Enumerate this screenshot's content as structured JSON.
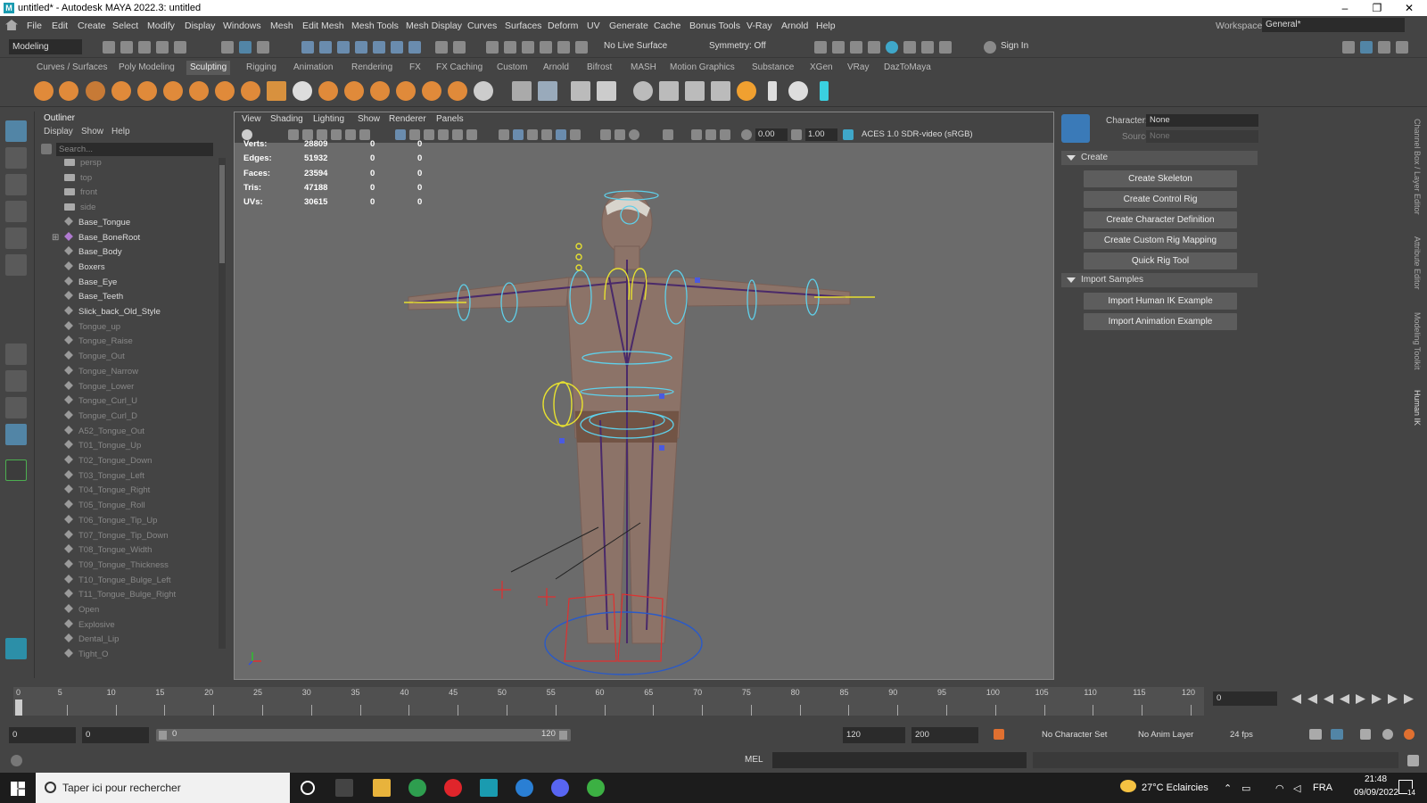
{
  "window": {
    "title": "untitled* - Autodesk MAYA 2022.3: untitled",
    "minimize": "–",
    "restore": "❐",
    "close": "✕"
  },
  "menubar": {
    "items": [
      "File",
      "Edit",
      "Create",
      "Select",
      "Modify",
      "Display",
      "Windows",
      "Mesh",
      "Edit Mesh",
      "Mesh Tools",
      "Mesh Display",
      "Curves",
      "Surfaces",
      "Deform",
      "UV",
      "Generate",
      "Cache",
      "Bonus Tools",
      "V-Ray",
      "Arnold",
      "Help"
    ],
    "workspace_label": "Workspace:",
    "workspace_value": "General*"
  },
  "toolbar": {
    "mode": "Modeling",
    "live_surface": "No Live Surface",
    "symmetry": "Symmetry: Off",
    "sign_in": "Sign In"
  },
  "shelf": {
    "tabs": [
      "Curves / Surfaces",
      "Poly Modeling",
      "Sculpting",
      "Rigging",
      "Animation",
      "Rendering",
      "FX",
      "FX Caching",
      "Custom",
      "Arnold",
      "Bifrost",
      "MASH",
      "Motion Graphics",
      "Substance",
      "XGen",
      "VRay",
      "DazToMaya"
    ],
    "active_tab": "Sculpting"
  },
  "outliner": {
    "title": "Outliner",
    "menus": [
      "Display",
      "Show",
      "Help"
    ],
    "search_placeholder": "Search...",
    "items": [
      {
        "label": "persp",
        "type": "camera"
      },
      {
        "label": "top",
        "type": "camera"
      },
      {
        "label": "front",
        "type": "camera"
      },
      {
        "label": "side",
        "type": "camera"
      },
      {
        "label": "Base_Tongue",
        "type": "mesh"
      },
      {
        "label": "Base_BoneRoot",
        "type": "joint"
      },
      {
        "label": "Base_Body",
        "type": "mesh"
      },
      {
        "label": "Boxers",
        "type": "mesh"
      },
      {
        "label": "Base_Eye",
        "type": "mesh"
      },
      {
        "label": "Base_Teeth",
        "type": "mesh"
      },
      {
        "label": "Slick_back_Old_Style",
        "type": "mesh"
      },
      {
        "label": "Tongue_up",
        "type": "blend"
      },
      {
        "label": "Tongue_Raise",
        "type": "blend"
      },
      {
        "label": "Tongue_Out",
        "type": "blend"
      },
      {
        "label": "Tongue_Narrow",
        "type": "blend"
      },
      {
        "label": "Tongue_Lower",
        "type": "blend"
      },
      {
        "label": "Tongue_Curl_U",
        "type": "blend"
      },
      {
        "label": "Tongue_Curl_D",
        "type": "blend"
      },
      {
        "label": "A52_Tongue_Out",
        "type": "blend"
      },
      {
        "label": "T01_Tongue_Up",
        "type": "blend"
      },
      {
        "label": "T02_Tongue_Down",
        "type": "blend"
      },
      {
        "label": "T03_Tongue_Left",
        "type": "blend"
      },
      {
        "label": "T04_Tongue_Right",
        "type": "blend"
      },
      {
        "label": "T05_Tongue_Roll",
        "type": "blend"
      },
      {
        "label": "T06_Tongue_Tip_Up",
        "type": "blend"
      },
      {
        "label": "T07_Tongue_Tip_Down",
        "type": "blend"
      },
      {
        "label": "T08_Tongue_Width",
        "type": "blend"
      },
      {
        "label": "T09_Tongue_Thickness",
        "type": "blend"
      },
      {
        "label": "T10_Tongue_Bulge_Left",
        "type": "blend"
      },
      {
        "label": "T11_Tongue_Bulge_Right",
        "type": "blend"
      },
      {
        "label": "Open",
        "type": "blend"
      },
      {
        "label": "Explosive",
        "type": "blend"
      },
      {
        "label": "Dental_Lip",
        "type": "blend"
      },
      {
        "label": "Tight_O",
        "type": "blend"
      }
    ]
  },
  "viewport": {
    "menus": [
      "View",
      "Shading",
      "Lighting",
      "Show",
      "Renderer",
      "Panels"
    ],
    "exposure": "0.00",
    "gamma": "1.00",
    "color_space": "ACES 1.0 SDR-video (sRGB)",
    "hud": [
      {
        "label": "Verts:",
        "value": "28809",
        "sel": "0",
        "comp": "0"
      },
      {
        "label": "Edges:",
        "value": "51932",
        "sel": "0",
        "comp": "0"
      },
      {
        "label": "Faces:",
        "value": "23594",
        "sel": "0",
        "comp": "0"
      },
      {
        "label": "Tris:",
        "value": "47188",
        "sel": "0",
        "comp": "0"
      },
      {
        "label": "UVs:",
        "value": "30615",
        "sel": "0",
        "comp": "0"
      }
    ]
  },
  "humanik": {
    "character_label": "Character:",
    "character_value": "None",
    "source_label": "Source:",
    "source_value": "None",
    "create_section": "Create",
    "create_buttons": [
      "Create Skeleton",
      "Create Control Rig",
      "Create Character Definition",
      "Create Custom Rig Mapping",
      "Quick Rig Tool"
    ],
    "import_section": "Import Samples",
    "import_buttons": [
      "Import Human IK Example",
      "Import Animation Example"
    ]
  },
  "side_tabs": [
    "Channel Box / Layer Editor",
    "Attribute Editor",
    "Modeling Toolkit",
    "Human IK"
  ],
  "timeline": {
    "ticks": [
      "5",
      "10",
      "15",
      "20",
      "25",
      "30",
      "35",
      "40",
      "45",
      "50",
      "55",
      "60",
      "65",
      "70",
      "75",
      "80",
      "85",
      "90",
      "95",
      "100",
      "105",
      "110",
      "115",
      "120"
    ],
    "start_tick": "0",
    "current_frame": "0"
  },
  "range": {
    "start": "0",
    "playback_start": "0",
    "slider_start": "0",
    "slider_end": "120",
    "playback_end": "120",
    "end": "200",
    "character_set": "No Character Set",
    "anim_layer": "No Anim Layer",
    "fps": "24 fps"
  },
  "cmdline": {
    "lang": "MEL"
  },
  "taskbar": {
    "search_placeholder": "Taper ici pour rechercher",
    "weather": "27°C  Eclaircies",
    "lang": "FRA",
    "time": "21:48",
    "date": "09/09/2022",
    "notifications": "14"
  },
  "colors": {
    "maya_bg": "#444444",
    "viewport_bg": "#6b6b6b",
    "selection": "#5285a6",
    "shelf_orange": "#e08a3a"
  }
}
